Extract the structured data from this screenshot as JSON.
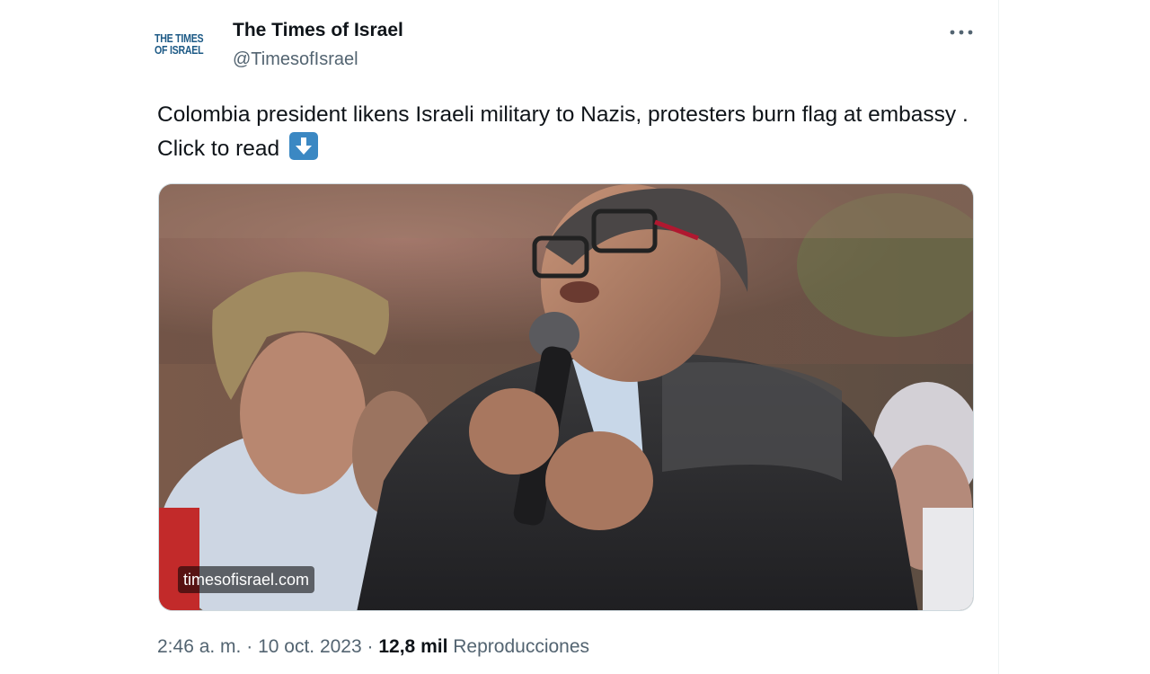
{
  "author": {
    "avatar_line1": "THE TIMES",
    "avatar_line2": "OF ISRAEL",
    "display_name": "The Times of Israel",
    "handle": "@TimesofIsrael"
  },
  "tweet": {
    "text": "Colombia president likens Israeli military to Nazis, protesters burn flag at embassy . Click to read",
    "emoji_icon": "down-arrow-emoji-icon"
  },
  "media": {
    "domain_badge": "timesofisrael.com"
  },
  "meta": {
    "time": "2:46 a. m.",
    "separator": "·",
    "date": "10 oct. 2023",
    "views_count": "12,8 mil",
    "views_label": "Reproducciones"
  },
  "colors": {
    "text_primary": "#0f1419",
    "text_secondary": "#536471",
    "emoji_blue": "#3b88c3",
    "border": "#cfd9de"
  },
  "icons": {
    "more": "more-horizontal-icon"
  }
}
